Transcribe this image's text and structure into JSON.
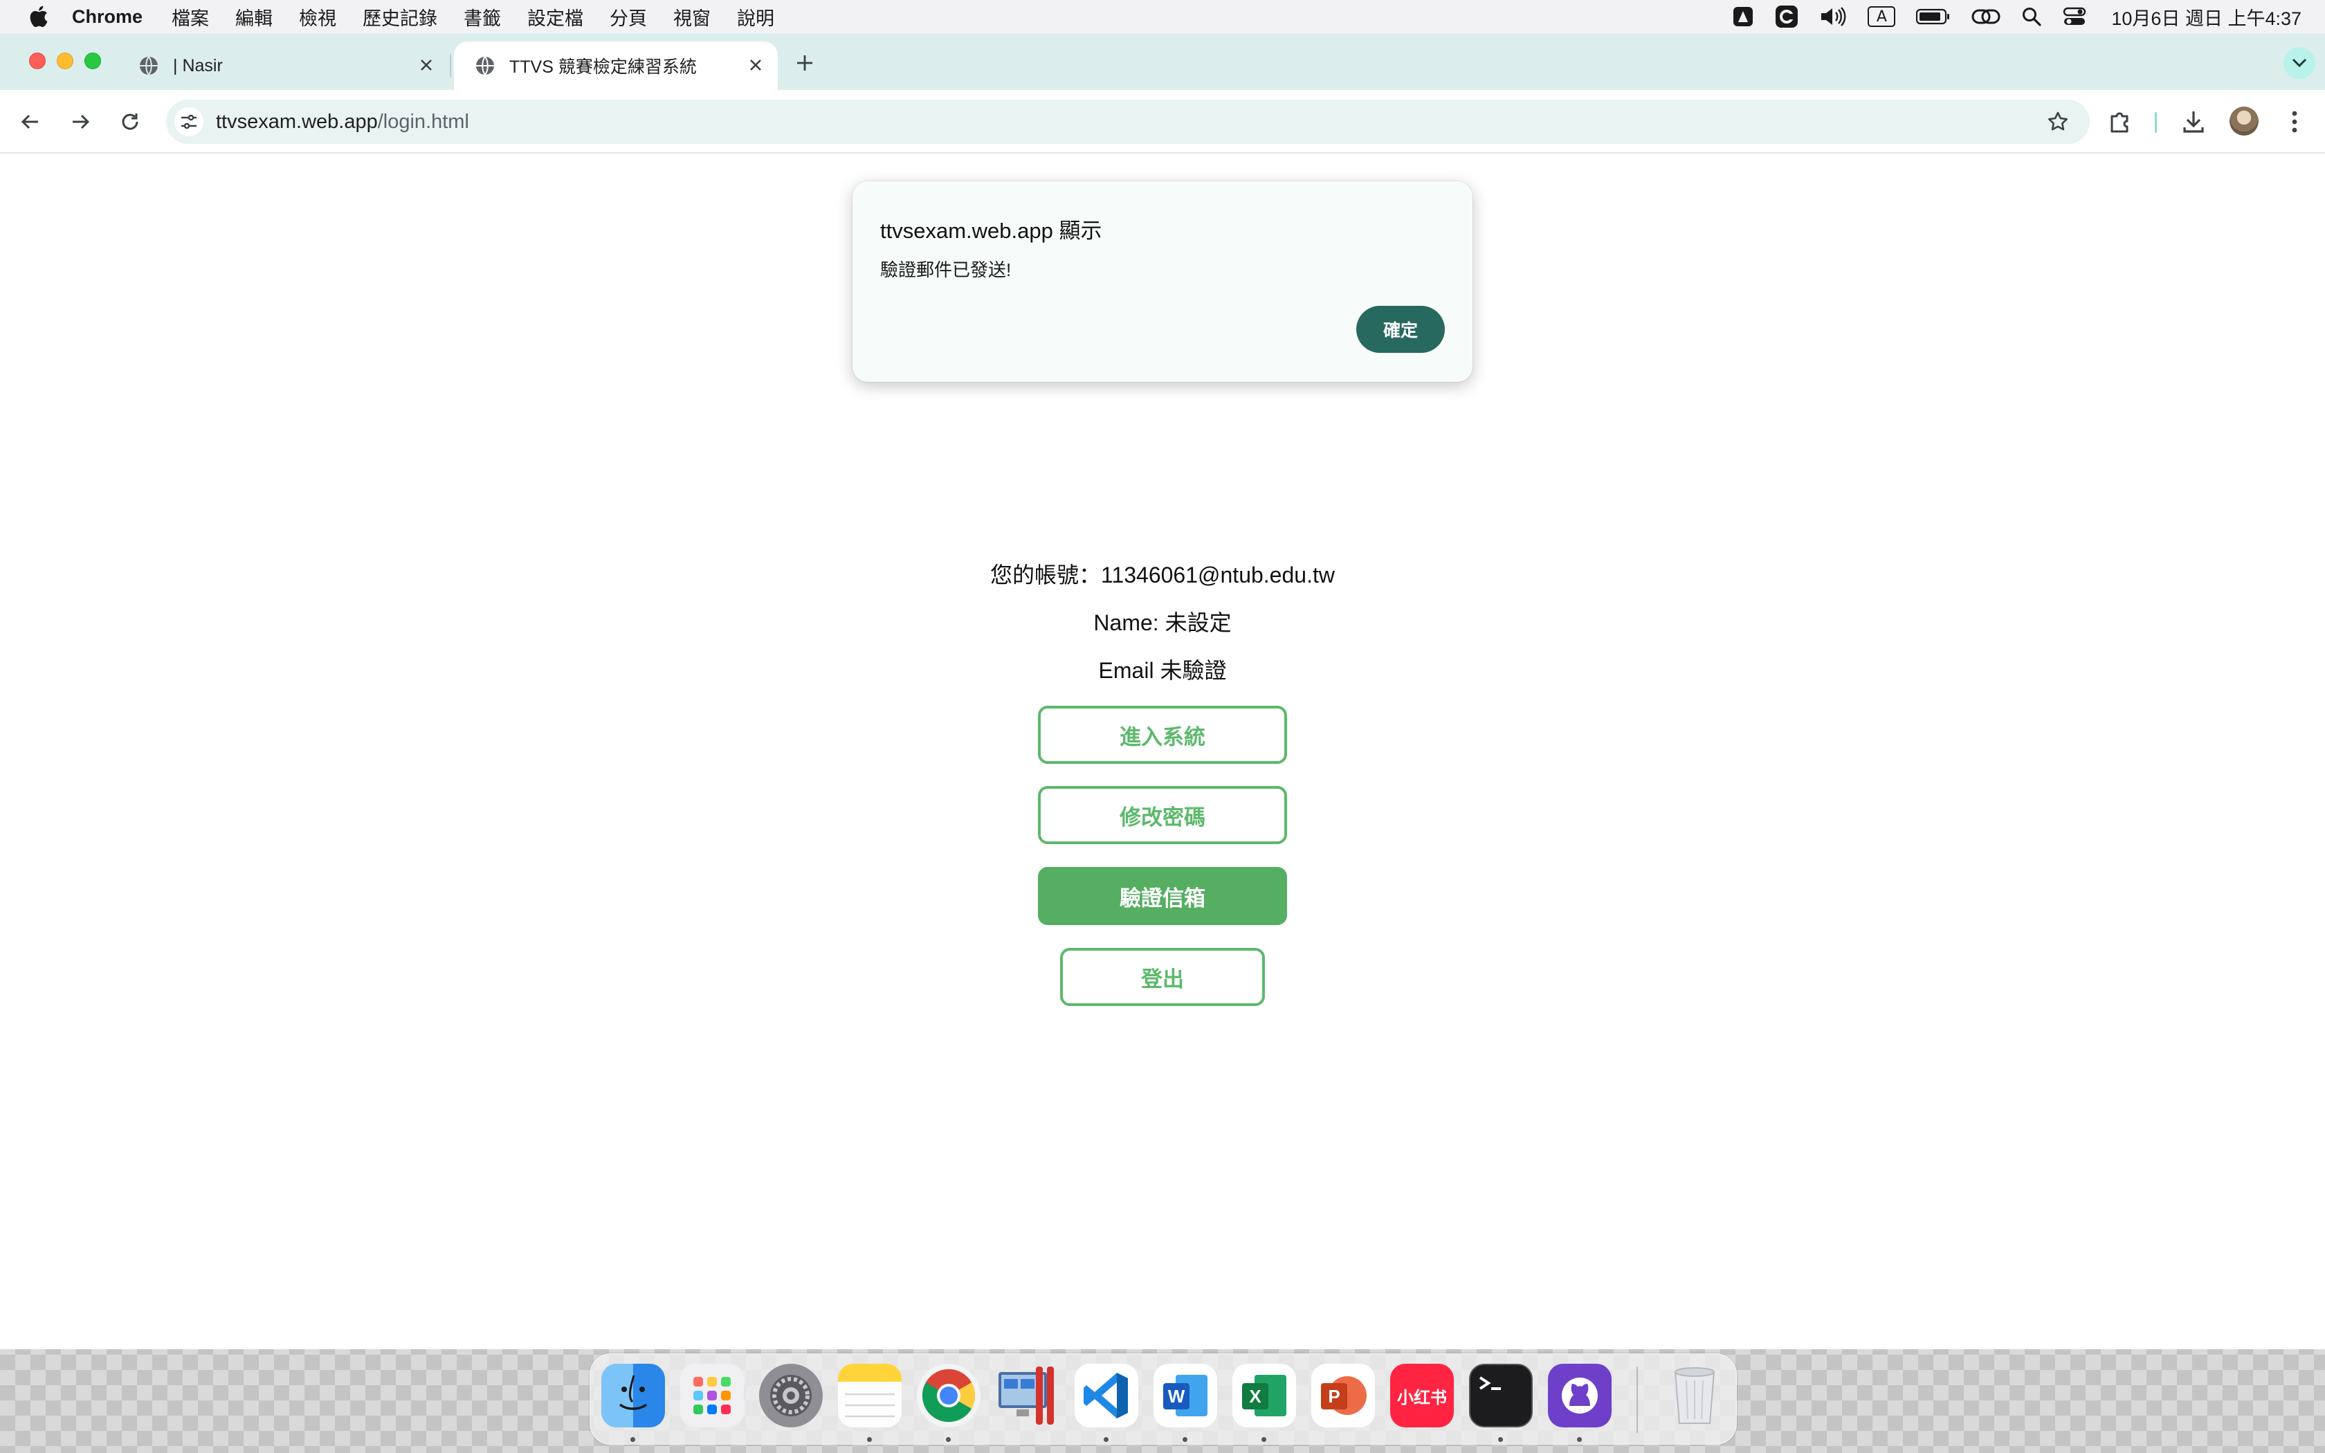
{
  "menubar": {
    "app_name": "Chrome",
    "items": [
      "檔案",
      "編輯",
      "檢視",
      "歷史記錄",
      "書籤",
      "設定檔",
      "分頁",
      "視窗",
      "說明"
    ],
    "clock": "10月6日 週日 上午4:37",
    "input_indicator": "A"
  },
  "tabs": [
    {
      "title": "| Nasir",
      "active": false
    },
    {
      "title": "TTVS 競賽檢定練習系統",
      "active": true
    }
  ],
  "address_bar": {
    "domain": "ttvsexam.web.app",
    "path": "/login.html"
  },
  "page": {
    "account_label": "您的帳號：11346061@ntub.edu.tw",
    "name_label": "Name: 未設定",
    "email_label": "Email 未驗證",
    "buttons": {
      "enter": "進入系統",
      "change_password": "修改密碼",
      "verify_email": "驗證信箱",
      "logout": "登出"
    }
  },
  "dialog": {
    "title": "ttvsexam.web.app 顯示",
    "message": "驗證郵件已發送!",
    "ok_label": "確定"
  },
  "dock": {
    "apps": [
      "finder-icon",
      "launchpad-icon",
      "system-settings-icon",
      "notes-icon",
      "chrome-icon",
      "parallels-icon",
      "vscode-icon",
      "word-icon",
      "excel-icon",
      "powerpoint-icon",
      "xiaohongshu-icon",
      "terminal-icon",
      "github-desktop-icon",
      "trash-icon"
    ],
    "xiaohongshu_label": "小红书"
  },
  "colors": {
    "accent_green": "#5cb96b",
    "filled_green": "#56ae63",
    "dialog_button": "#27695f",
    "tabbar": "#dbeeec"
  }
}
